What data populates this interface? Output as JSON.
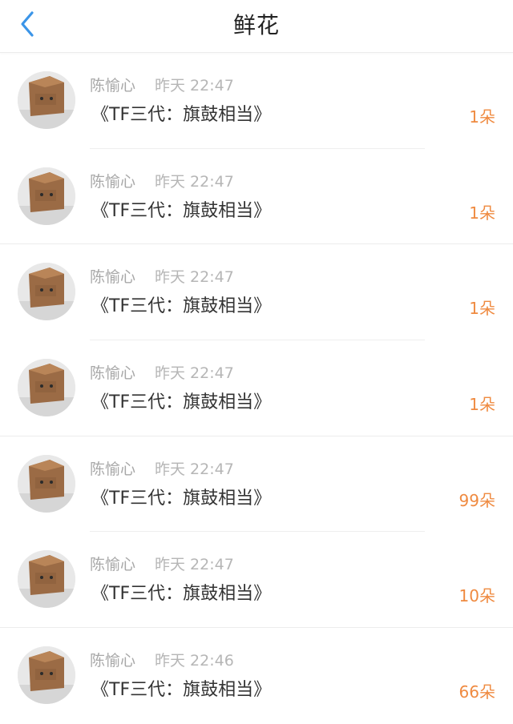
{
  "header": {
    "title": "鲜花",
    "back_icon": "chevron-left-icon",
    "accent_color": "#3b95e8"
  },
  "records": [
    {
      "sender": "陈愉心",
      "time": "昨天 22:47",
      "title": "《TF三代：旗鼓相当》",
      "count": "1朵"
    },
    {
      "sender": "陈愉心",
      "time": "昨天 22:47",
      "title": "《TF三代：旗鼓相当》",
      "count": "1朵"
    },
    {
      "sender": "陈愉心",
      "time": "昨天 22:47",
      "title": "《TF三代：旗鼓相当》",
      "count": "1朵"
    },
    {
      "sender": "陈愉心",
      "time": "昨天 22:47",
      "title": "《TF三代：旗鼓相当》",
      "count": "1朵"
    },
    {
      "sender": "陈愉心",
      "time": "昨天 22:47",
      "title": "《TF三代：旗鼓相当》",
      "count": "99朵"
    },
    {
      "sender": "陈愉心",
      "time": "昨天 22:47",
      "title": "《TF三代：旗鼓相当》",
      "count": "10朵"
    },
    {
      "sender": "陈愉心",
      "time": "昨天 22:46",
      "title": "《TF三代：旗鼓相当》",
      "count": "66朵"
    }
  ],
  "colors": {
    "count": "#ef8a40",
    "meta": "#b6b6b6",
    "title": "#333333"
  }
}
